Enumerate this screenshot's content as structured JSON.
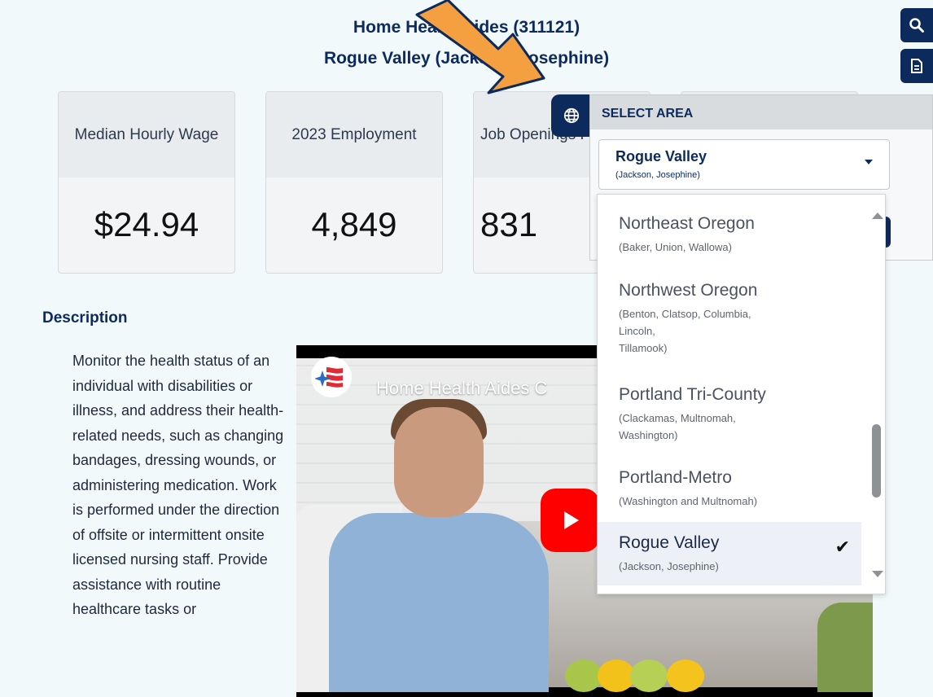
{
  "header": {
    "title_line1": "Home Health Aides (311121)",
    "title_line2": "Rogue Valley (Jackson, Josephine)"
  },
  "cards": [
    {
      "label": "Median Hourly Wage",
      "value": "$24.94"
    },
    {
      "label": "2023 Employment",
      "value": "4,849"
    },
    {
      "label": "Job Openings Per Year",
      "value": "831"
    }
  ],
  "side_toolbar": {
    "search_icon": "search-icon",
    "report_icon": "document-icon"
  },
  "area_selector": {
    "header": "SELECT AREA",
    "selected_name": "Rogue Valley",
    "selected_sub": "(Jackson, Josephine)",
    "globe_icon": "globe-icon"
  },
  "dropdown": {
    "options": [
      {
        "name": "Northeast Oregon",
        "sub": "(Baker, Union, Wallowa)"
      },
      {
        "name": "Northwest Oregon",
        "sub": "(Benton, Clatsop, Columbia,\nLincoln,\nTillamook)"
      },
      {
        "name": "Portland Tri-County",
        "sub": "(Clackamas, Multnomah,\nWashington)"
      },
      {
        "name": "Portland-Metro",
        "sub": "(Washington and Multnomah)"
      },
      {
        "name": "Rogue Valley",
        "sub": "(Jackson, Josephine)",
        "selected": true
      }
    ]
  },
  "description": {
    "heading": "Description",
    "text": "Monitor the health status of an individual with disabilities or illness, and address their health-related needs, such as changing bandages, dressing wounds, or administering medication. Work is performed under the direction of offsite or intermittent onsite licensed nursing staff. Provide assistance with routine healthcare tasks or"
  },
  "video": {
    "title": "Home Health Aides C"
  },
  "colors": {
    "navy": "#0d2a5c",
    "background": "#f1f9fb",
    "arrow": "#f4a041",
    "youtube_red": "#ff0000"
  }
}
